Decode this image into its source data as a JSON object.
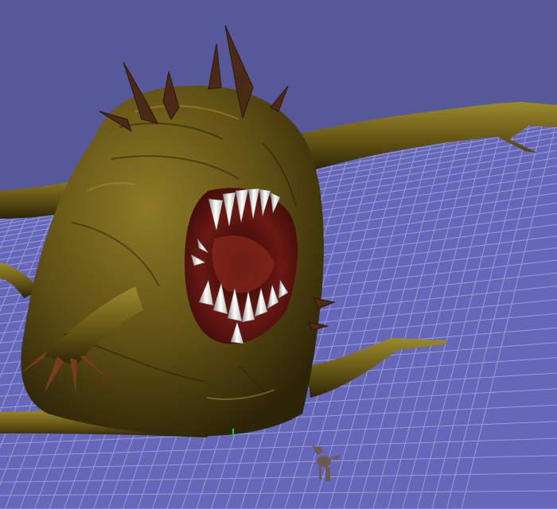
{
  "viewport": {
    "background_color": "#57589a",
    "ground_color": "#6667b8",
    "grid_line_color": "#a9aee6"
  },
  "scene": {
    "creature": {
      "skin_color": "#5f5014",
      "skin_highlight": "#8c7a26",
      "skin_shadow": "#2c2406",
      "spike_color": "#4a2a16",
      "mouth_color": "#5a1410",
      "tooth_color": "#e6e6e0"
    },
    "small_character": {
      "color": "#6b5a4e"
    },
    "origin_marker": {
      "color": "#22c83a"
    }
  }
}
